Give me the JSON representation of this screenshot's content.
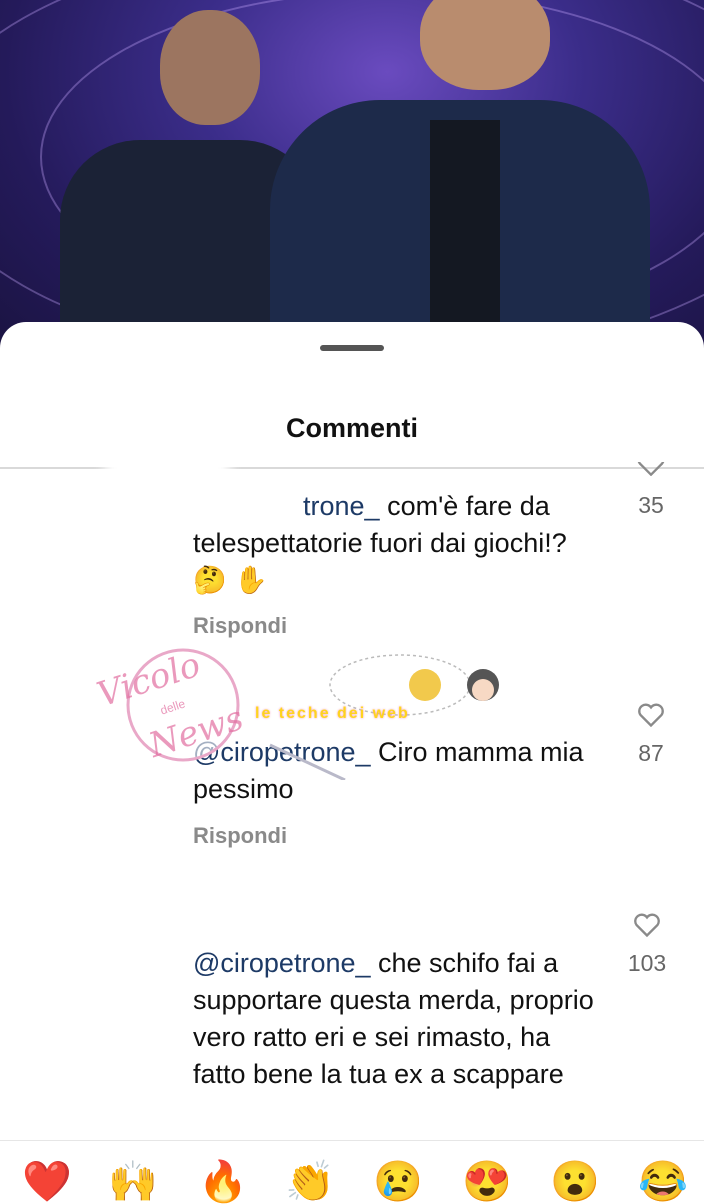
{
  "sheet": {
    "title": "Commenti"
  },
  "comments": [
    {
      "mention": "@ciropetrone_",
      "mention_visible": "trone_",
      "text": " com'è fare da telespettatorie fuori dai giochi!? 🤔 ✋",
      "likes": "35",
      "reply": "Rispondi"
    },
    {
      "mention": "@ciropetrone_",
      "text": " Ciro mamma mia pessimo",
      "likes": "87",
      "reply": "Rispondi"
    },
    {
      "mention": "@ciropetrone_",
      "text": " che schifo fai a supportare questa merda, proprio vero ratto eri e sei rimasto, ha fatto bene la tua ex a scappare",
      "likes": "103"
    }
  ],
  "watermarks": {
    "vicolo": "Vicolo",
    "delle": "delle",
    "news": "News",
    "web": "le teche dei web"
  },
  "reactions": [
    "❤️",
    "🙌",
    "🔥",
    "👏",
    "😢",
    "😍",
    "😮",
    "😂"
  ]
}
